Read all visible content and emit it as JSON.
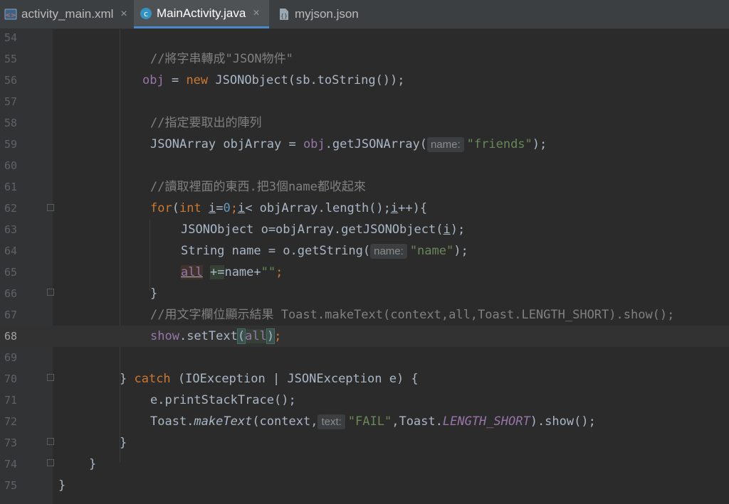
{
  "tabs": [
    {
      "label": "activity_main.xml",
      "icon": "xml-file-icon",
      "active": false,
      "close": "×"
    },
    {
      "label": "MainActivity.java",
      "icon": "java-class-icon",
      "active": true,
      "close": "×"
    },
    {
      "label": "myjson.json",
      "icon": "json-file-icon",
      "active": false,
      "close": ""
    }
  ],
  "lines": [
    {
      "num": "54"
    },
    {
      "num": "55",
      "comment": "//將字串轉成\"JSON物件\""
    },
    {
      "num": "56",
      "t1": "obj",
      "t2": " = ",
      "t3": "new",
      "t4": " JSONObject(sb.toString());"
    },
    {
      "num": "57"
    },
    {
      "num": "58",
      "comment": "//指定要取出的陣列"
    },
    {
      "num": "59",
      "t1": "JSONArray objArray = ",
      "t2": "obj",
      "t3": ".getJSONArray(",
      "hint": "name:",
      "str": "\"friends\"",
      "t4": ");"
    },
    {
      "num": "60"
    },
    {
      "num": "61",
      "comment": "//讀取裡面的東西.把3個name都收起來"
    },
    {
      "num": "62",
      "kw": "for",
      "t1": "(",
      "kw2": "int",
      "v1": "i",
      "t2": "=",
      "n1": "0",
      "t3": ";",
      "v2": "i",
      "t4": "< objArray.length();",
      "v3": "i",
      "t5": "++){"
    },
    {
      "num": "63",
      "t1": "JSONObject o=objArray.getJSONObject(",
      "v1": "i",
      "t2": ");"
    },
    {
      "num": "64",
      "t1": "String name = o.getString(",
      "hint": "name:",
      "str": "\"name\"",
      "t2": ");"
    },
    {
      "num": "65",
      "f1": "all",
      "t1": " ",
      "op": "+=",
      "t2": "name+",
      "str": "\"\"",
      "t3": ";"
    },
    {
      "num": "66",
      "t1": "}"
    },
    {
      "num": "67",
      "comment": "//用文字欄位顯示結果 Toast.makeText(context,all,Toast.LENGTH_SHORT).show();"
    },
    {
      "num": "68",
      "f1": "show",
      "t1": ".setText",
      "p1": "(",
      "f2": "all",
      "p2": ")",
      "t2": ";"
    },
    {
      "num": "69"
    },
    {
      "num": "70",
      "t1": "} ",
      "kw": "catch",
      "t2": " (IOException | JSONException e) {"
    },
    {
      "num": "71",
      "t1": "e.printStackTrace();"
    },
    {
      "num": "72",
      "t1": "Toast.",
      "m1": "makeText",
      "t2": "(context,",
      "hint": "text:",
      "str": "\"FAIL\"",
      "t3": ",Toast.",
      "s1": "LENGTH_SHORT",
      "t4": ").show();"
    },
    {
      "num": "73",
      "t1": "}"
    },
    {
      "num": "74",
      "t1": "}"
    },
    {
      "num": "75",
      "t1": "}"
    }
  ]
}
